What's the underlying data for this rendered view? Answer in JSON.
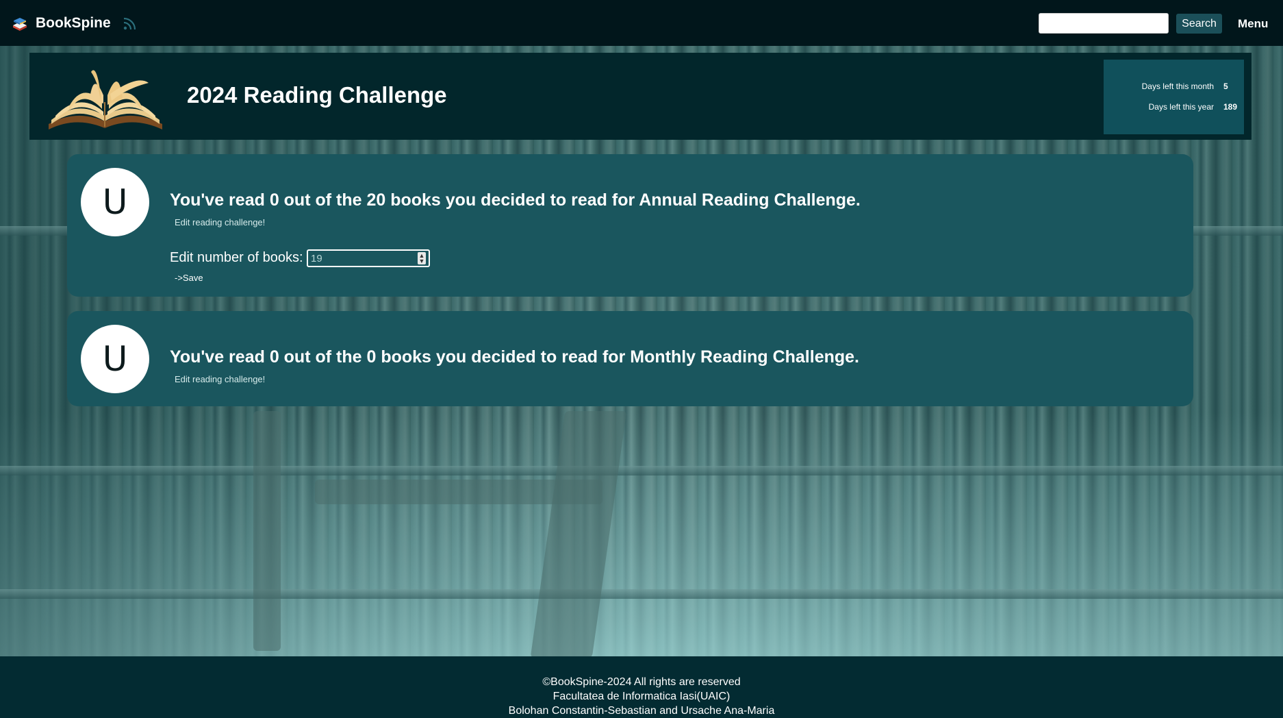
{
  "app": {
    "brand_name": "BookSpine",
    "search_button_label": "Search",
    "search_placeholder": "",
    "menu_label": "Menu"
  },
  "banner": {
    "title": "2024 Reading Challenge",
    "days": [
      {
        "label": "Days left this month",
        "value": "5"
      },
      {
        "label": "Days left this year",
        "value": "189"
      }
    ]
  },
  "challenges": [
    {
      "avatar_letter": "U",
      "text": "You've read 0 out of the 20 books you decided to read for Annual Reading Challenge.",
      "edit_link": "Edit reading challenge!",
      "edit_label": "Edit number of books:",
      "edit_value": "19",
      "save_label": "->Save"
    },
    {
      "avatar_letter": "U",
      "text": "You've read 0 out of the 0 books you decided to read for Monthly Reading Challenge.",
      "edit_link": "Edit reading challenge!"
    }
  ],
  "footer": {
    "line1": "©BookSpine-2024 All rights are reserved",
    "line2": "Facultatea de Informatica Iasi(UAIC)",
    "line3": "Bolohan Constantin-Sebastian and Ursache Ana-Maria"
  },
  "colors": {
    "navbar": "#01161b",
    "banner": "#02262b",
    "card": "#1a565e",
    "footer": "#032b32",
    "days_box": "#10505b",
    "search_button": "#1b4f59"
  },
  "icons": {
    "logo": "books-stack-icon",
    "feed": "rss-feed-icon",
    "banner_image": "open-book-icon",
    "stepper": "number-stepper-icon"
  }
}
